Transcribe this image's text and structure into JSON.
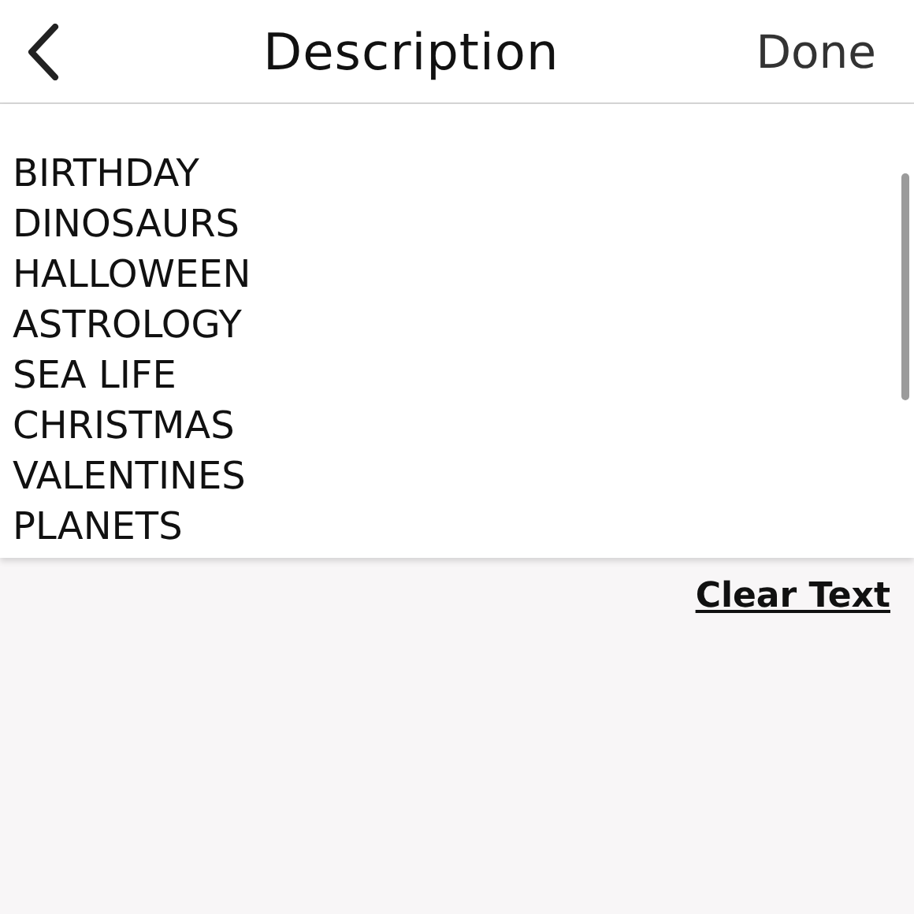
{
  "header": {
    "title": "Description",
    "done": "Done"
  },
  "description": {
    "lines": [
      "BIRTHDAY",
      "DINOSAURS",
      "HALLOWEEN",
      "ASTROLOGY",
      "SEA LIFE",
      "CHRISTMAS",
      "VALENTINES",
      "PLANETS"
    ]
  },
  "clear_text": "Clear Text"
}
